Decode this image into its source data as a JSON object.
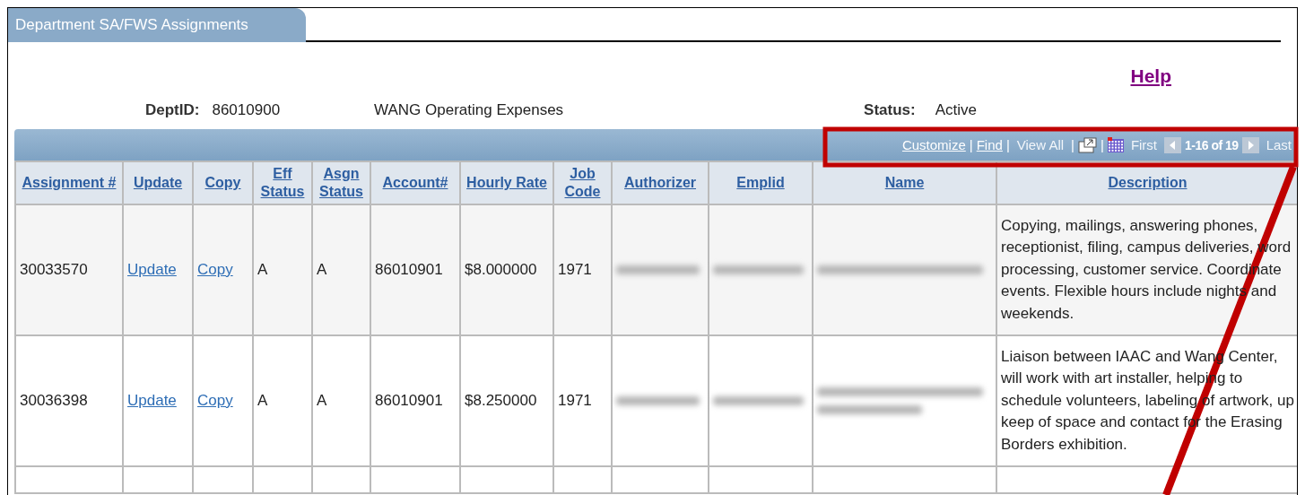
{
  "tab": {
    "label": "Department SA/FWS Assignments",
    "selected": true
  },
  "help_link": "Help",
  "header": {
    "dept_label": "DeptID:",
    "dept_id": "86010900",
    "dept_name": "WANG Operating Expenses",
    "status_label": "Status:",
    "status": "Active"
  },
  "grid_nav": [
    {
      "kind": "link",
      "text": "Customize",
      "disabled": false
    },
    {
      "kind": "separator",
      "text": "|"
    },
    {
      "kind": "link",
      "text": "Find",
      "disabled": false
    },
    {
      "kind": "separator",
      "text": "|"
    },
    {
      "kind": "link",
      "text": "View All",
      "disabled": true
    },
    {
      "kind": "separator",
      "text": "|"
    },
    {
      "kind": "popup-icon"
    },
    {
      "kind": "separator",
      "text": "|"
    },
    {
      "kind": "grid-icon"
    },
    {
      "kind": "link",
      "text": "First",
      "disabled": true
    },
    {
      "kind": "prev-icon",
      "disabled": true
    },
    {
      "kind": "count",
      "text": "1-16 of 19"
    },
    {
      "kind": "next-icon",
      "disabled": true
    },
    {
      "kind": "link",
      "text": "Last",
      "disabled": true
    }
  ],
  "table": {
    "columns": [
      "Assignment #",
      "Update",
      "Copy",
      "Eff Status",
      "Asgn Status",
      "Account#",
      "Hourly Rate",
      "Job Code",
      "Authorizer",
      "Emplid",
      "Name",
      "Description"
    ],
    "rows": [
      {
        "assignment": "30033570",
        "update": "Update",
        "copy": "Copy",
        "eff_status": "A",
        "asgn_status": "A",
        "account": "86010901",
        "hourly_rate": "$8.000000",
        "job_code": "1971",
        "authorizer": {
          "kind": "blurred"
        },
        "emplid": {
          "kind": "blurred"
        },
        "name": {
          "kind": "blurred"
        },
        "description": "Copying, mailings, answering phones, receptionist, filing, campus deliveries, word processing, customer service.  Coordinate events.   Flexible hours include nights and weekends."
      },
      {
        "assignment": "30036398",
        "update": "Update",
        "copy": "Copy",
        "eff_status": "A",
        "asgn_status": "A",
        "account": "86010901",
        "hourly_rate": "$8.250000",
        "job_code": "1971",
        "authorizer": {
          "kind": "blurred"
        },
        "emplid": {
          "kind": "blurred"
        },
        "name": {
          "kind": "blurred-wrapped"
        },
        "description": "Liaison between IAAC and Wang Center, will work with art installer, helping to schedule volunteers, labeling of artwork,  up keep of space and contact for the Erasing Borders exhibition."
      }
    ]
  }
}
